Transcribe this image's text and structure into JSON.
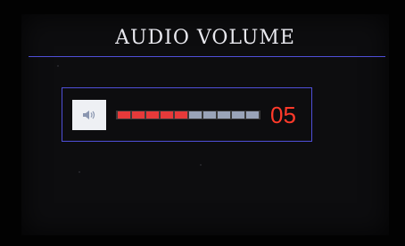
{
  "screen": {
    "title": "AUDIO VOLUME"
  },
  "volume": {
    "icon": "speaker-icon",
    "level_text": "05",
    "level": 5,
    "max": 10
  },
  "colors": {
    "accent_line": "#4f4fd8",
    "segment_on": "#e53a3a",
    "segment_off": "#9aa4b8",
    "level_text": "#ff3a2a"
  }
}
